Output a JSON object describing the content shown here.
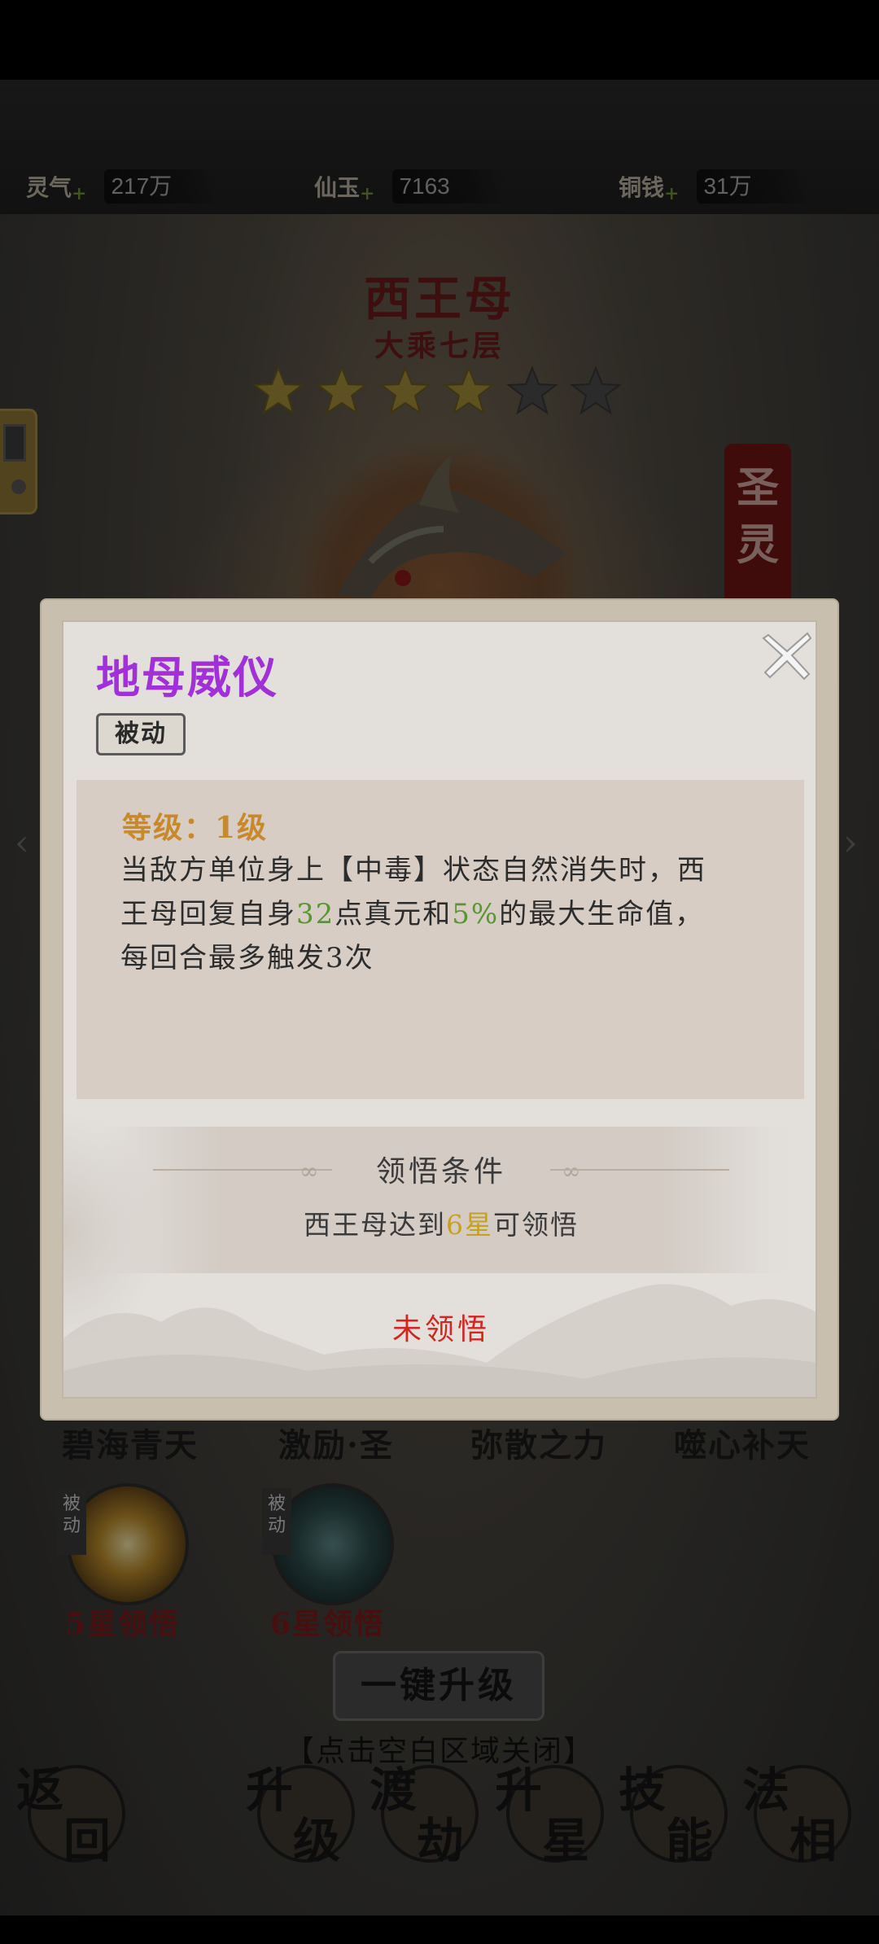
{
  "resources": [
    {
      "label": "灵气",
      "value": "217万"
    },
    {
      "label": "仙玉",
      "value": "7163"
    },
    {
      "label": "铜钱",
      "value": "31万"
    }
  ],
  "character": {
    "name": "西王母",
    "rank": "大乘七层",
    "stars_filled": 4,
    "stars_total": 6,
    "banner": "圣灵"
  },
  "modal": {
    "title": "地母威仪",
    "badge": "被动",
    "level": "等级：1级",
    "desc_1": "当敌方单位身上【中毒】状态自然消失时，西",
    "desc_2a": "王母回复自身",
    "desc_2b": "32",
    "desc_2c": "点真元和",
    "desc_2d": "5%",
    "desc_2e": "的最大生命值，",
    "desc_3": "每回合最多触发3次",
    "condition_title": "领悟条件",
    "condition_a": "西王母达到",
    "condition_b": "6星",
    "condition_c": "可领悟",
    "status": "未领悟"
  },
  "skills": [
    {
      "name": "碧海青天"
    },
    {
      "name": "激励·圣"
    },
    {
      "name": "弥散之力"
    },
    {
      "name": "噬心补天"
    }
  ],
  "locked_skills": [
    {
      "tag": "被动",
      "condition": "5星领悟"
    },
    {
      "tag": "被动",
      "condition": "6星领悟"
    }
  ],
  "upgrade_button": "一键升级",
  "close_hint": "【点击空白区域关闭】",
  "nav": [
    {
      "c1": "返",
      "c2": "回"
    },
    {
      "c1": "升",
      "c2": "级"
    },
    {
      "c1": "渡",
      "c2": "劫"
    },
    {
      "c1": "升",
      "c2": "星"
    },
    {
      "c1": "技",
      "c2": "能"
    },
    {
      "c1": "法",
      "c2": "相"
    }
  ],
  "colors": {
    "title_purple": "#a230d8",
    "level_gold": "#c8892a",
    "value_green": "#58962f",
    "star_yellow": "#c9a01c",
    "status_red": "#d4261f"
  }
}
